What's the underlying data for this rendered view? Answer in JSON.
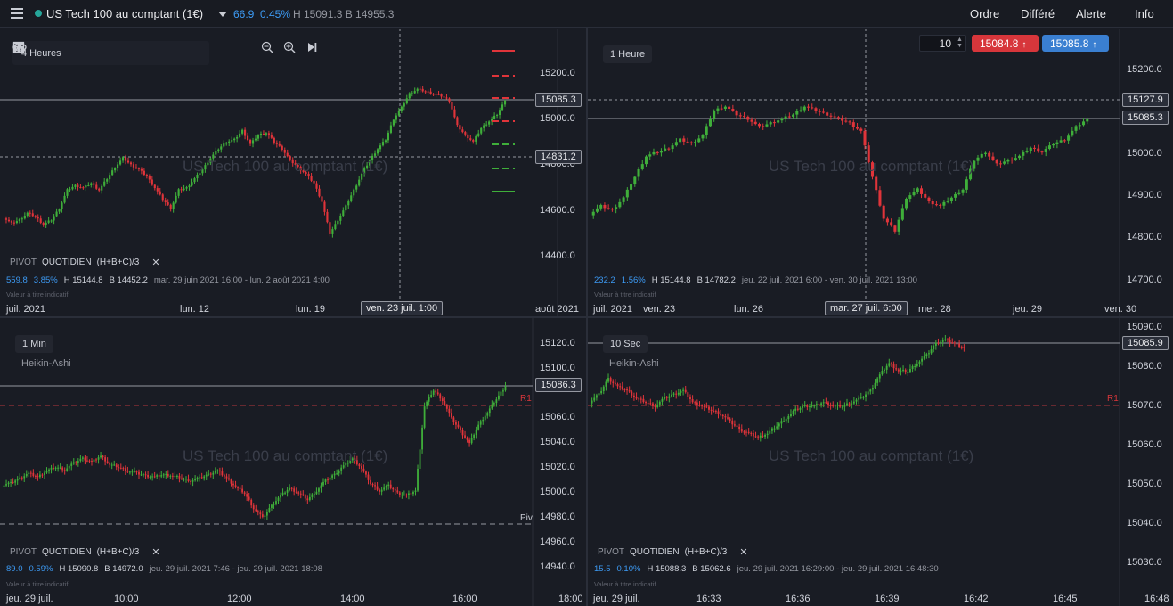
{
  "header": {
    "symbol": "US Tech 100 au comptant (1€)",
    "last": "66.9",
    "pct": "0.45%",
    "high_low": "H 15091.3  B 14955.3",
    "menu": [
      "Ordre",
      "Différé",
      "Alerte",
      "Info"
    ]
  },
  "trade": {
    "quantity": "10",
    "sell": "15084.8",
    "buy": "15085.8"
  },
  "toolbar": {
    "interval": "4 Heures"
  },
  "watermark": "US Tech 100 au comptant (1€)",
  "disclaimer": "Valeur à titre indicatif",
  "panels": [
    {
      "interval": "4 Heures",
      "indicator": {
        "pivot": "PIVOT",
        "period": "QUOTIDIEN",
        "formula": "(H+B+C)/3"
      },
      "stats": {
        "chg": "559.8",
        "pct": "3.85%",
        "h": "H 15144.8",
        "b": "B 14452.2",
        "range": "mar. 29 juin 2021 16:00 - lun. 2 août 2021 4:00"
      },
      "price_axis": [
        "15200.0",
        "15000.0",
        "14800.0",
        "14600.0",
        "14400.0"
      ],
      "time_axis": [
        "juil. 2021",
        "lun. 12",
        "lun. 19",
        "ven. 23 juil. 1:00",
        "août 2021"
      ],
      "last_price": "15085.3",
      "cross_price": "14831.2"
    },
    {
      "interval": "1 Heure",
      "stats": {
        "chg": "232.2",
        "pct": "1.56%",
        "h": "H 15144.8",
        "b": "B 14782.2",
        "range": "jeu. 22 juil. 2021 6:00 - ven. 30 juil. 2021 13:00"
      },
      "price_axis": [
        "15200.0",
        "15100.0",
        "15000.0",
        "14900.0",
        "14800.0",
        "14700.0"
      ],
      "time_axis": [
        "juil. 2021",
        "ven. 23",
        "lun. 26",
        "mar. 27 juil. 6:00",
        "mer. 28",
        "jeu. 29",
        "ven. 30"
      ],
      "cross_price": "15127.9",
      "last_price": "15085.3"
    },
    {
      "interval": "1 Min",
      "style": "Heikin-Ashi",
      "indicator": {
        "pivot": "PIVOT",
        "period": "QUOTIDIEN",
        "formula": "(H+B+C)/3"
      },
      "stats": {
        "chg": "89.0",
        "pct": "0.59%",
        "h": "H 15090.8",
        "b": "B 14972.0",
        "range": "jeu. 29 juil. 2021 7:46 - jeu. 29 juil. 2021 18:08"
      },
      "price_axis": [
        "15120.0",
        "15100.0",
        "15080.0",
        "15060.0",
        "15040.0",
        "15020.0",
        "15000.0",
        "14980.0",
        "14960.0",
        "14940.0"
      ],
      "time_axis": [
        "jeu. 29 juil.",
        "10:00",
        "12:00",
        "14:00",
        "16:00",
        "18:00"
      ],
      "last_price": "15086.3",
      "r1": "R1",
      "piv": "Piv"
    },
    {
      "interval": "10 Sec",
      "style": "Heikin-Ashi",
      "indicator": {
        "pivot": "PIVOT",
        "period": "QUOTIDIEN",
        "formula": "(H+B+C)/3"
      },
      "stats": {
        "chg": "15.5",
        "pct": "0.10%",
        "h": "H 15088.3",
        "b": "B 15062.6",
        "range": "jeu. 29 juil. 2021 16:29:00 - jeu. 29 juil. 2021 16:48:30"
      },
      "price_axis": [
        "15090.0",
        "15080.0",
        "15070.0",
        "15060.0",
        "15050.0",
        "15040.0",
        "15030.0"
      ],
      "time_axis": [
        "jeu. 29 juil.",
        "16:33",
        "16:36",
        "16:39",
        "16:42",
        "16:45",
        "16:48"
      ],
      "last_price": "15085.9",
      "r1": "R1"
    }
  ],
  "series": {
    "p1": [
      14570,
      14545,
      14560,
      14590,
      14575,
      14540,
      14560,
      14610,
      14690,
      14710,
      14700,
      14720,
      14690,
      14740,
      14790,
      14830,
      14800,
      14780,
      14750,
      14700,
      14650,
      14610,
      14690,
      14700,
      14740,
      14780,
      14830,
      14870,
      14900,
      14910,
      14950,
      14890,
      14930,
      14940,
      14900,
      14870,
      14820,
      14790,
      14760,
      14720,
      14640,
      14500,
      14560,
      14620,
      14690,
      14760,
      14820,
      14870,
      14910,
      15000,
      15050,
      15110,
      15130,
      15120,
      15110,
      15100,
      15080,
      14970,
      14930,
      14900,
      14960,
      14990,
      15020,
      15080
    ],
    "p2": [
      14860,
      14880,
      14870,
      14900,
      14950,
      15000,
      15010,
      15020,
      15040,
      15030,
      15050,
      15110,
      15120,
      15100,
      15090,
      15070,
      15080,
      15090,
      15100,
      15120,
      15110,
      15100,
      15090,
      15080,
      15060,
      14950,
      14850,
      14820,
      14900,
      14920,
      14890,
      14880,
      14900,
      14920,
      14990,
      15010,
      14980,
      14990,
      15000,
      15020,
      15010,
      15030,
      15040,
      15070,
      15090
    ],
    "p3": [
      15006,
      15008,
      15012,
      15016,
      15013,
      15018,
      15021,
      15019,
      15024,
      15028,
      15025,
      15030,
      15023,
      15021,
      15018,
      15016,
      15014,
      15013,
      15015,
      15014,
      15012,
      15010,
      15012,
      15015,
      15018,
      15012,
      15005,
      15000,
      14988,
      14980,
      14990,
      14998,
      15004,
      15000,
      14995,
      15002,
      15010,
      15015,
      15022,
      15028,
      15020,
      15008,
      15002,
      15006,
      15000,
      14998,
      15002,
      15070,
      15083,
      15075,
      15060,
      15050,
      15040,
      15055,
      15065,
      15076,
      15086
    ],
    "p4": [
      15071,
      15073,
      15077,
      15075,
      15074,
      15072,
      15071,
      15070,
      15072,
      15073,
      15074,
      15071,
      15070,
      15069,
      15068,
      15066,
      15064,
      15063,
      15062,
      15063,
      15065,
      15067,
      15069,
      15070,
      15070,
      15071,
      15070,
      15070,
      15071,
      15072,
      15074,
      15078,
      15081,
      15079,
      15079,
      15081,
      15083,
      15086,
      15087,
      15086,
      15085
    ]
  }
}
